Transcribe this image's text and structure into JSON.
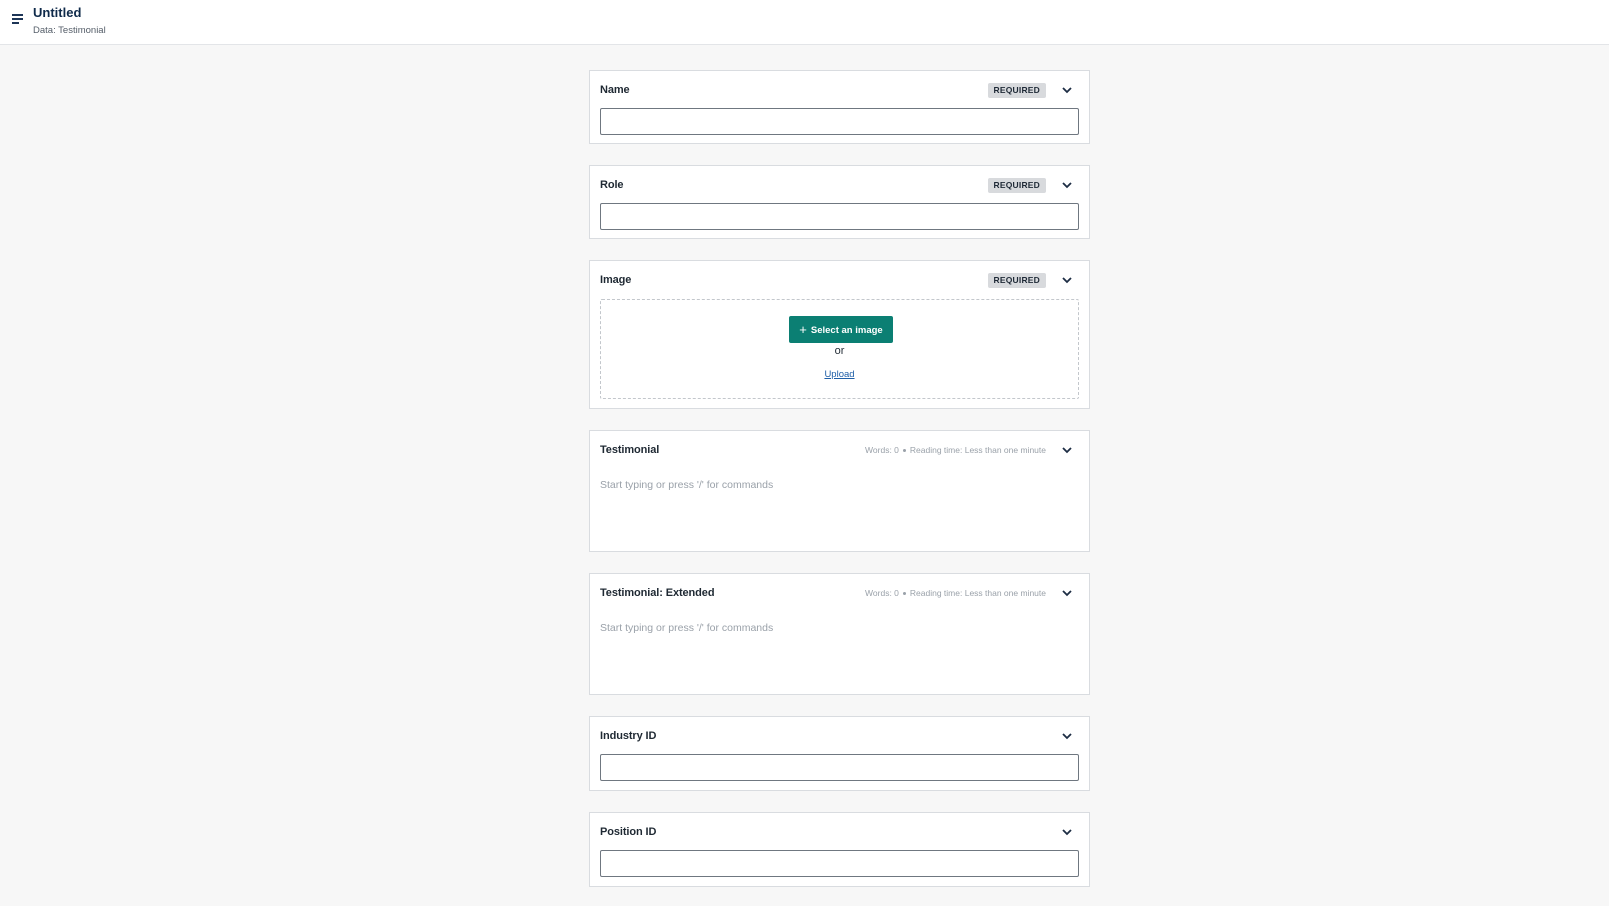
{
  "header": {
    "title": "Untitled",
    "subtitle": "Data: Testimonial"
  },
  "fields": {
    "name": {
      "label": "Name",
      "badge": "REQUIRED",
      "value": ""
    },
    "role": {
      "label": "Role",
      "badge": "REQUIRED",
      "value": ""
    },
    "image": {
      "label": "Image",
      "badge": "REQUIRED",
      "select_button": "Select an image",
      "or": "or",
      "upload": "Upload"
    },
    "testimonial": {
      "label": "Testimonial",
      "words": "Words: 0",
      "reading_time": "Reading time: Less than one minute",
      "placeholder": "Start typing or press '/' for commands"
    },
    "testimonial_extended": {
      "label": "Testimonial: Extended",
      "words": "Words: 0",
      "reading_time": "Reading time: Less than one minute",
      "placeholder": "Start typing or press '/' for commands"
    },
    "industry_id": {
      "label": "Industry ID",
      "value": ""
    },
    "position_id": {
      "label": "Position ID",
      "value": ""
    }
  },
  "icons": {
    "menu": "menu-icon",
    "chevron": "chevron-down-icon",
    "plus": "plus-icon"
  },
  "colors": {
    "primary_button": "#0b7f73",
    "link": "#1f5fa8",
    "badge_bg": "#d8dadd",
    "page_bg": "#f7f7f7"
  }
}
